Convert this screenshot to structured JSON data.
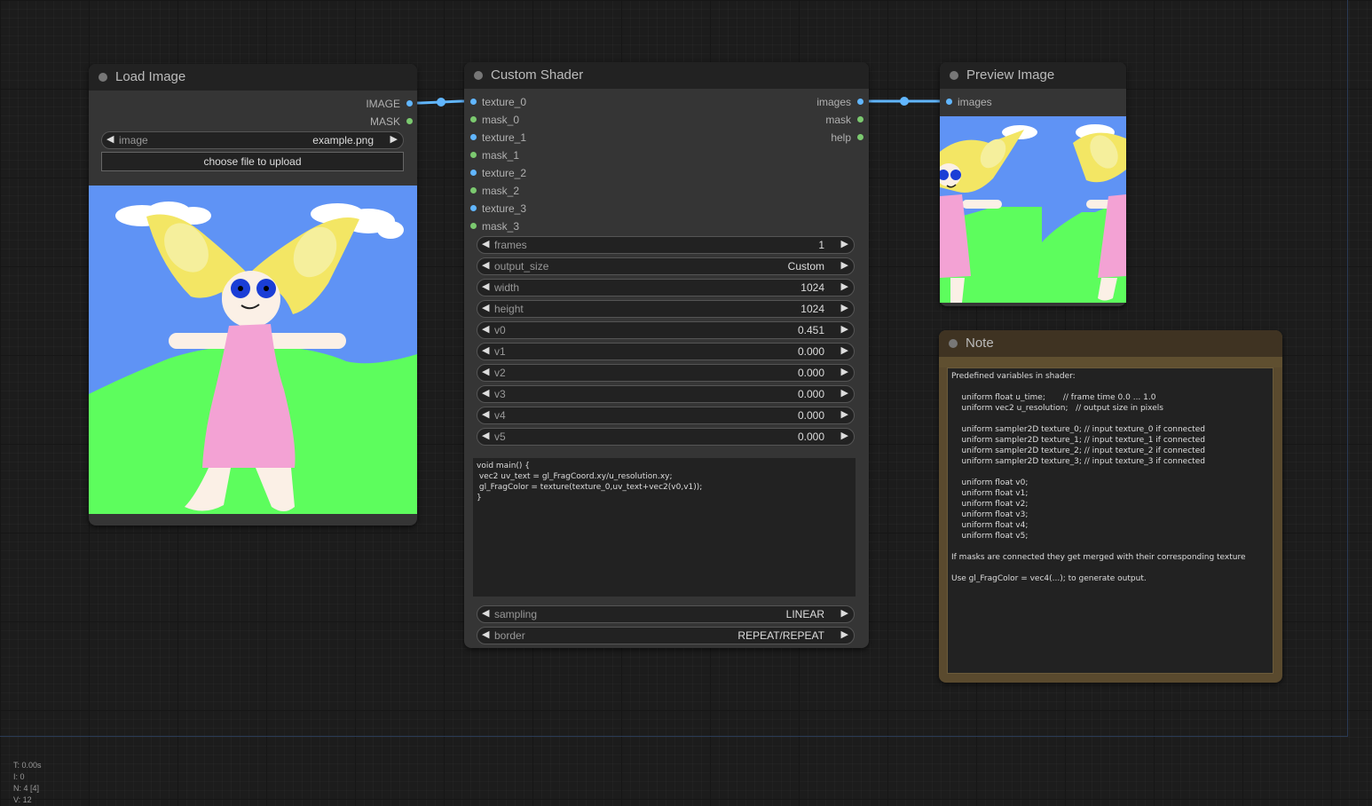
{
  "load_image": {
    "title": "Load Image",
    "outputs": [
      "IMAGE",
      "MASK"
    ],
    "image_widget": {
      "label": "image",
      "value": "example.png"
    },
    "upload_button": "choose file to upload"
  },
  "custom_shader": {
    "title": "Custom Shader",
    "inputs": [
      "texture_0",
      "mask_0",
      "texture_1",
      "mask_1",
      "texture_2",
      "mask_2",
      "texture_3",
      "mask_3"
    ],
    "outputs": [
      "images",
      "mask",
      "help"
    ],
    "widgets": [
      {
        "label": "frames",
        "value": "1"
      },
      {
        "label": "output_size",
        "value": "Custom"
      },
      {
        "label": "width",
        "value": "1024"
      },
      {
        "label": "height",
        "value": "1024"
      },
      {
        "label": "v0",
        "value": "0.451"
      },
      {
        "label": "v1",
        "value": "0.000"
      },
      {
        "label": "v2",
        "value": "0.000"
      },
      {
        "label": "v3",
        "value": "0.000"
      },
      {
        "label": "v4",
        "value": "0.000"
      },
      {
        "label": "v5",
        "value": "0.000"
      }
    ],
    "code": "void main() {\n vec2 uv_text = gl_FragCoord.xy/u_resolution.xy;\n gl_FragColor = texture(texture_0,uv_text+vec2(v0,v1));\n}",
    "bottom_widgets": [
      {
        "label": "sampling",
        "value": "LINEAR"
      },
      {
        "label": "border",
        "value": "REPEAT/REPEAT"
      }
    ]
  },
  "preview_image": {
    "title": "Preview Image",
    "input": "images"
  },
  "note": {
    "title": "Note",
    "text": "Predefined variables in shader:\n\n    uniform float u_time;       // frame time 0.0 ... 1.0\n    uniform vec2 u_resolution;   // output size in pixels\n\n    uniform sampler2D texture_0; // input texture_0 if connected\n    uniform sampler2D texture_1; // input texture_1 if connected\n    uniform sampler2D texture_2; // input texture_2 if connected\n    uniform sampler2D texture_3; // input texture_3 if connected\n\n    uniform float v0;\n    uniform float v1;\n    uniform float v2;\n    uniform float v3;\n    uniform float v4;\n    uniform float v5;\n\nIf masks are connected they get merged with their corresponding texture\n\nUse gl_FragColor = vec4(...); to generate output."
  },
  "stats": {
    "t": "T: 0.00s",
    "i": "I: 0",
    "n": "N: 4 [4]",
    "v": "V: 12"
  },
  "colors": {
    "image_slot": "#61b6ff",
    "mask_slot": "#7bc96f",
    "link": "#61b6ff",
    "note_bg": "#5a4a2e"
  }
}
